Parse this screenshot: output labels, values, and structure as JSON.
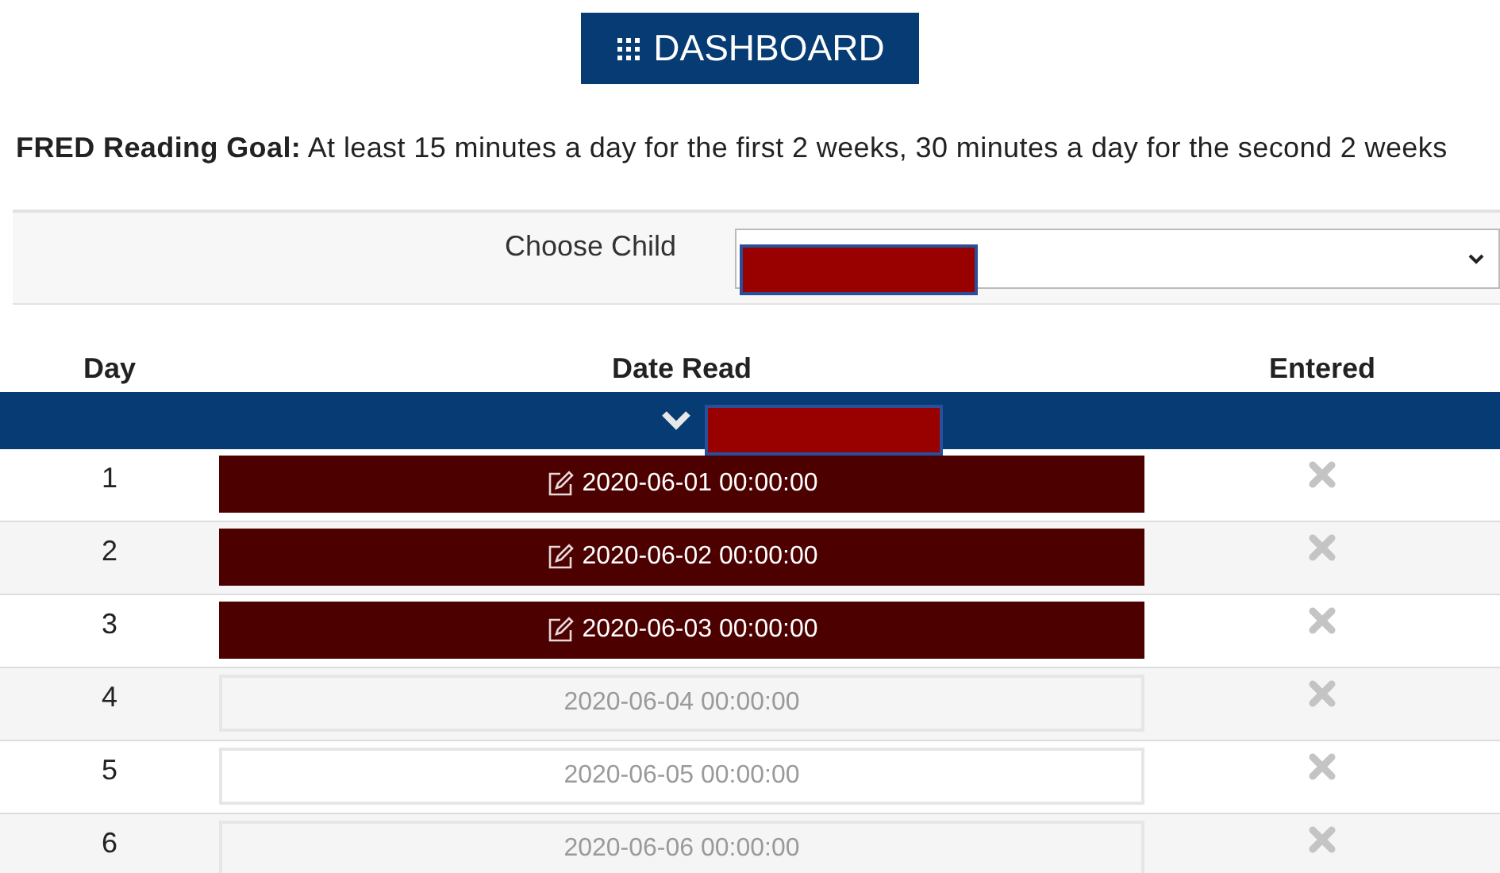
{
  "dashboard_button": {
    "label": "DASHBOARD"
  },
  "goal": {
    "text": "**FRED Reading Goal:** At least 15 minutes a day for the first 2 weeks, 30 minutes a day for the second 2 weeks"
  },
  "choose_child": {
    "label": "Choose Child"
  },
  "table": {
    "columns": [
      "Day",
      "Date Read",
      "Entered"
    ],
    "rows": [
      {
        "day": "1",
        "date": "2020-06-01 00:00:00",
        "read": true
      },
      {
        "day": "2",
        "date": "2020-06-02 00:00:00",
        "read": true
      },
      {
        "day": "3",
        "date": "2020-06-03 00:00:00",
        "read": true
      },
      {
        "day": "4",
        "date": "2020-06-04 00:00:00",
        "read": false
      },
      {
        "day": "5",
        "date": "2020-06-05 00:00:00",
        "read": false
      },
      {
        "day": "6",
        "date": "2020-06-06 00:00:00",
        "read": false
      }
    ]
  }
}
